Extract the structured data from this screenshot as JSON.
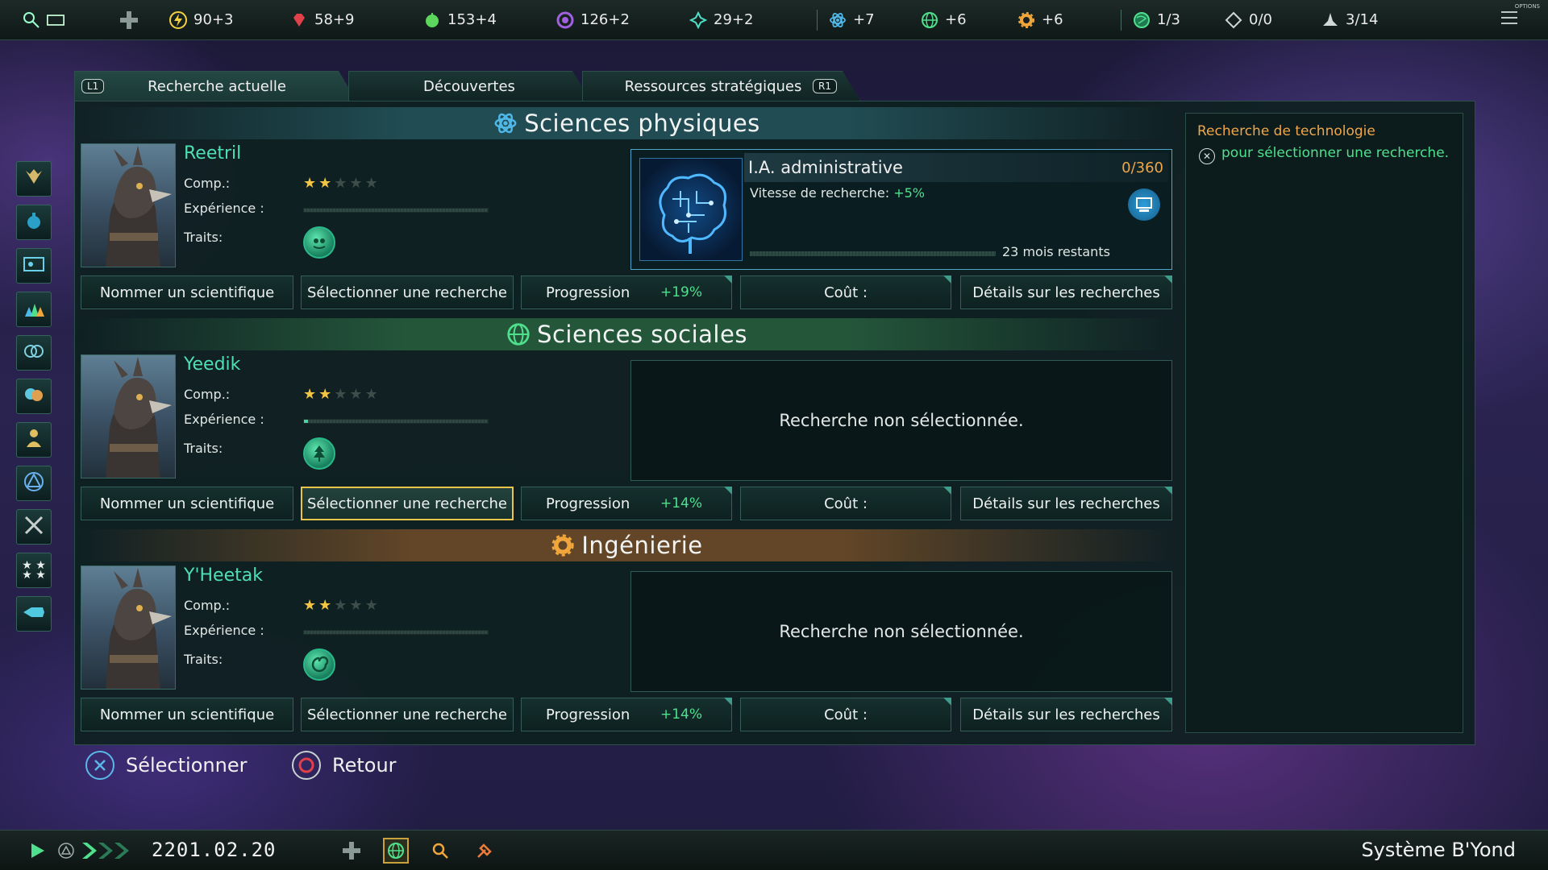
{
  "topbar": {
    "resources": [
      {
        "icon": "energy-icon",
        "value": "90+3",
        "color": "#f5d142"
      },
      {
        "icon": "minerals-icon",
        "value": "58+9",
        "color": "#e0414a"
      },
      {
        "icon": "food-icon",
        "value": "153+4",
        "color": "#5cd65c"
      },
      {
        "icon": "influence-icon",
        "value": "126+2",
        "color": "#a060e0"
      },
      {
        "icon": "unity-icon",
        "value": "29+2",
        "color": "#4fe0c8"
      }
    ],
    "research": [
      {
        "icon": "physics-icon",
        "value": "+7",
        "color": "#4fb8e8"
      },
      {
        "icon": "society-icon",
        "value": "+6",
        "color": "#4fe08d"
      },
      {
        "icon": "engineering-icon",
        "value": "+6",
        "color": "#f0a63a"
      }
    ],
    "limits": [
      {
        "icon": "planets-icon",
        "value": "1/3",
        "color": "#4fe08d"
      },
      {
        "icon": "edicts-icon",
        "value": "0/0",
        "color": "#d0d8d6"
      },
      {
        "icon": "fleet-icon",
        "value": "3/14",
        "color": "#d0d8d6"
      }
    ],
    "options_label": "OPTIONS"
  },
  "tabs": {
    "prev_key": "L1",
    "next_key": "R1",
    "items": [
      "Recherche actuelle",
      "Découvertes",
      "Ressources stratégiques"
    ]
  },
  "labels": {
    "skill": "Comp.:",
    "experience": "Expérience :",
    "traits": "Traits:",
    "assign": "Nommer un scientifique",
    "select": "Sélectionner une recherche",
    "progress": "Progression",
    "cost": "Coût :",
    "details": "Détails sur les recherches",
    "not_selected": "Recherche non sélectionnée."
  },
  "sections": [
    {
      "title": "Sciences physiques",
      "scientist": {
        "name": "Reetril",
        "stars": 2,
        "max_stars": 5,
        "xp": 0
      },
      "progress_pct": "+19%",
      "tech": {
        "name": "I.A. administrative",
        "progress": "0/360",
        "effect_label": "Vitesse de recherche:",
        "effect_value": "+5%",
        "remaining": "23 mois restants"
      }
    },
    {
      "title": "Sciences sociales",
      "scientist": {
        "name": "Yeedik",
        "stars": 2,
        "max_stars": 5,
        "xp": 0.02
      },
      "progress_pct": "+14%"
    },
    {
      "title": "Ingénierie",
      "scientist": {
        "name": "Y'Heetak",
        "stars": 2,
        "max_stars": 5,
        "xp": 0
      },
      "progress_pct": "+14%"
    }
  ],
  "info_panel": {
    "title": "Recherche de technologie",
    "line": "pour sélectionner une recherche."
  },
  "hints": {
    "select": "Sélectionner",
    "back": "Retour"
  },
  "bottombar": {
    "date": "2201.02.20",
    "location": "Système B'Yond"
  }
}
